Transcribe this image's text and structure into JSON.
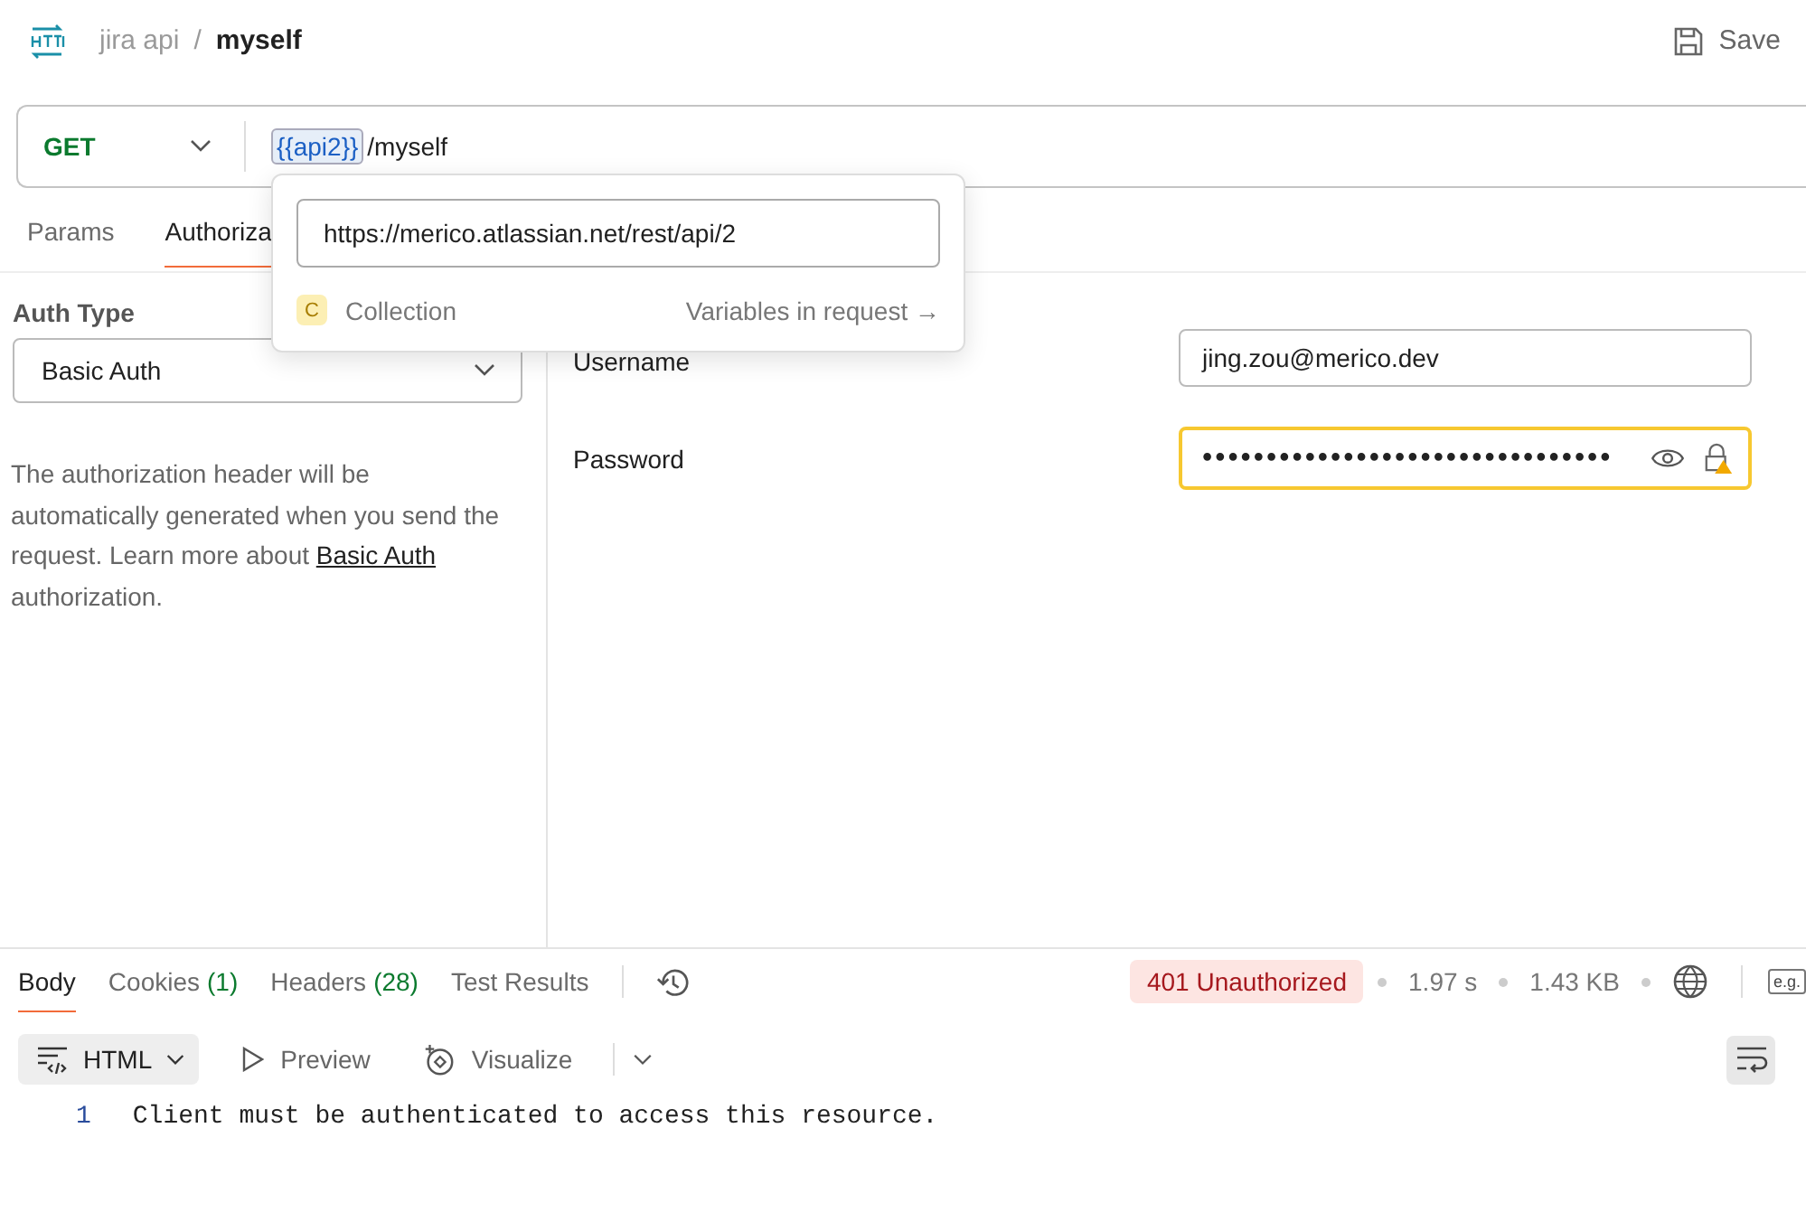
{
  "header": {
    "collection": "jira api",
    "separator": "/",
    "request": "myself",
    "save": "Save"
  },
  "request": {
    "method": "GET",
    "variable": "{{api2}}",
    "path": "/myself"
  },
  "tabs": [
    {
      "label": "Params",
      "selected": false
    },
    {
      "label": "Authoriza",
      "selected": true
    }
  ],
  "variable_popup": {
    "value": "https://merico.atlassian.net/rest/api/2",
    "scope_badge": "C",
    "scope": "Collection",
    "link": "Variables in request →"
  },
  "auth": {
    "type_label": "Auth Type",
    "type": "Basic Auth",
    "description": "The authorization header will be automatically generated when you send the request. Learn more about ",
    "link": "Basic Auth",
    "description_end": " authorization."
  },
  "fields": [
    {
      "label": "Username",
      "value": "jing.zou@merico.dev",
      "kind": "text"
    },
    {
      "label": "Password",
      "value": "••••••••••••••••••••••••••••••••",
      "kind": "password"
    }
  ],
  "response": {
    "tabs": [
      {
        "label": "Body",
        "selected": true
      },
      {
        "label": "Cookies",
        "count": "(1)",
        "selected": false
      },
      {
        "label": "Headers",
        "count": "(28)",
        "selected": false
      },
      {
        "label": "Test Results",
        "selected": false
      }
    ],
    "status": "401 Unauthorized",
    "time": "1.97 s",
    "size": "1.43 KB",
    "example": "e.g.",
    "format": "HTML",
    "preview": "Preview",
    "visualize": "Visualize",
    "lines": [
      {
        "number": "1",
        "text": "Client must be authenticated to access this resource."
      }
    ]
  }
}
